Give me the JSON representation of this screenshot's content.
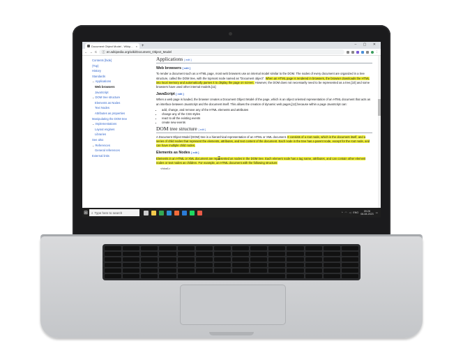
{
  "browser": {
    "tab_title": "Document Object Model - Wikip...",
    "tab_close": "×",
    "new_tab": "+",
    "window_buttons": "– ▢ ✕",
    "url": "en.wikipedia.org/wiki/Document_Object_Model",
    "nav": {
      "back": "←",
      "forward": "→",
      "reload": "C",
      "info": "ⓘ"
    }
  },
  "toc": [
    {
      "label": "Contents [hide]",
      "level": 0,
      "state": "normal"
    },
    {
      "label": "(Top)",
      "level": 0,
      "state": "normal"
    },
    {
      "label": "History",
      "level": 0,
      "state": "normal"
    },
    {
      "label": "Standards",
      "level": 0,
      "state": "normal"
    },
    {
      "label": "Applications",
      "level": 0,
      "state": "expanded"
    },
    {
      "label": "Web browsers",
      "level": 1,
      "state": "active"
    },
    {
      "label": "JavaScript",
      "level": 1,
      "state": "normal"
    },
    {
      "label": "DOM tree structure",
      "level": 0,
      "state": "expanded"
    },
    {
      "label": "Elements as Nodes",
      "level": 1,
      "state": "normal"
    },
    {
      "label": "Text Nodes",
      "level": 1,
      "state": "normal"
    },
    {
      "label": "Attributes as properties",
      "level": 1,
      "state": "normal"
    },
    {
      "label": "Manipulating the DOM tree",
      "level": 0,
      "state": "normal"
    },
    {
      "label": "Implementations",
      "level": 0,
      "state": "expanded"
    },
    {
      "label": "Layout engines",
      "level": 1,
      "state": "normal"
    },
    {
      "label": "Libraries",
      "level": 1,
      "state": "normal"
    },
    {
      "label": "See also",
      "level": 0,
      "state": "normal"
    },
    {
      "label": "References",
      "level": 0,
      "state": "expanded"
    },
    {
      "label": "General references",
      "level": 1,
      "state": "normal"
    },
    {
      "label": "External links",
      "level": 0,
      "state": "normal"
    }
  ],
  "article": {
    "applications_heading": "Applications",
    "edit_label": "[ edit ]",
    "web_browsers_heading": "Web browsers",
    "web_browsers_p1_a": "To render a document such as a HTML page, most web browsers use an internal model similar to the DOM. The nodes of every document are organized in a tree structure, called the DOM tree, with the topmost node named as \"Document object\". ",
    "web_browsers_p1_hl": "When an HTML page is rendered in browsers, the browser downloads the HTML into local memory and automatically parses it to display the page on screen.",
    "web_browsers_p1_b": " However, the DOM does not necessarily need to be represented as a tree,[10] and some browsers have used other internal models.[11]",
    "javascript_heading": "JavaScript",
    "javascript_p": "When a web page is loaded, the browser creates a Document Object Model of the page, which is an object oriented representation of an HTML document that acts as an interface between JavaScript and the document itself. This allows the creation of dynamic web pages,[12] because within a page JavaScript can:",
    "javascript_list": [
      "add, change, and remove any of the HTML elements and attributes",
      "change any of the CSS styles",
      "react to all the existing events",
      "create new events"
    ],
    "dom_tree_heading": "DOM tree structure",
    "dom_tree_p_a": "A Document Object Model (DOM) tree is a hierarchical representation of an HTML or XML document. ",
    "dom_tree_p_hl": "It consists of a root node, which is the document itself, and a series of child nodes that represent the elements, attributes, and text content of the document. Each node in the tree has a parent node, except for the root node, and can have multiple child nodes.",
    "elements_heading": "Elements as Nodes",
    "elements_p_hl": "Elements in an HTML or XML document are represented as nodes in the DOM tree. Each element node has a tag name, attributes, and can contain other element nodes or text nodes as children. For example, an HTML document with the following structure:",
    "code_snippet": "<html>"
  },
  "taskbar": {
    "search_placeholder": "Type here to search",
    "tray_lang": "ENG",
    "time": "09:28",
    "date": "08-08-2023",
    "icons": [
      {
        "name": "task-view-icon",
        "color": "#cccccc"
      },
      {
        "name": "file-explorer-icon",
        "color": "#f2c94c"
      },
      {
        "name": "chrome-icon",
        "color": "#34a853"
      },
      {
        "name": "edge-icon",
        "color": "#2f8fd5"
      },
      {
        "name": "brave-icon",
        "color": "#f26b3a"
      },
      {
        "name": "vscode-icon",
        "color": "#2b7bd6"
      },
      {
        "name": "spotify-icon",
        "color": "#1ed760"
      },
      {
        "name": "store-icon",
        "color": "#e95a48"
      }
    ]
  },
  "colors": {
    "highlight": "#f5f53a",
    "link": "#3366cc",
    "laptop_bezel": "#1b1b1d",
    "laptop_body": "#c4c6c9"
  }
}
